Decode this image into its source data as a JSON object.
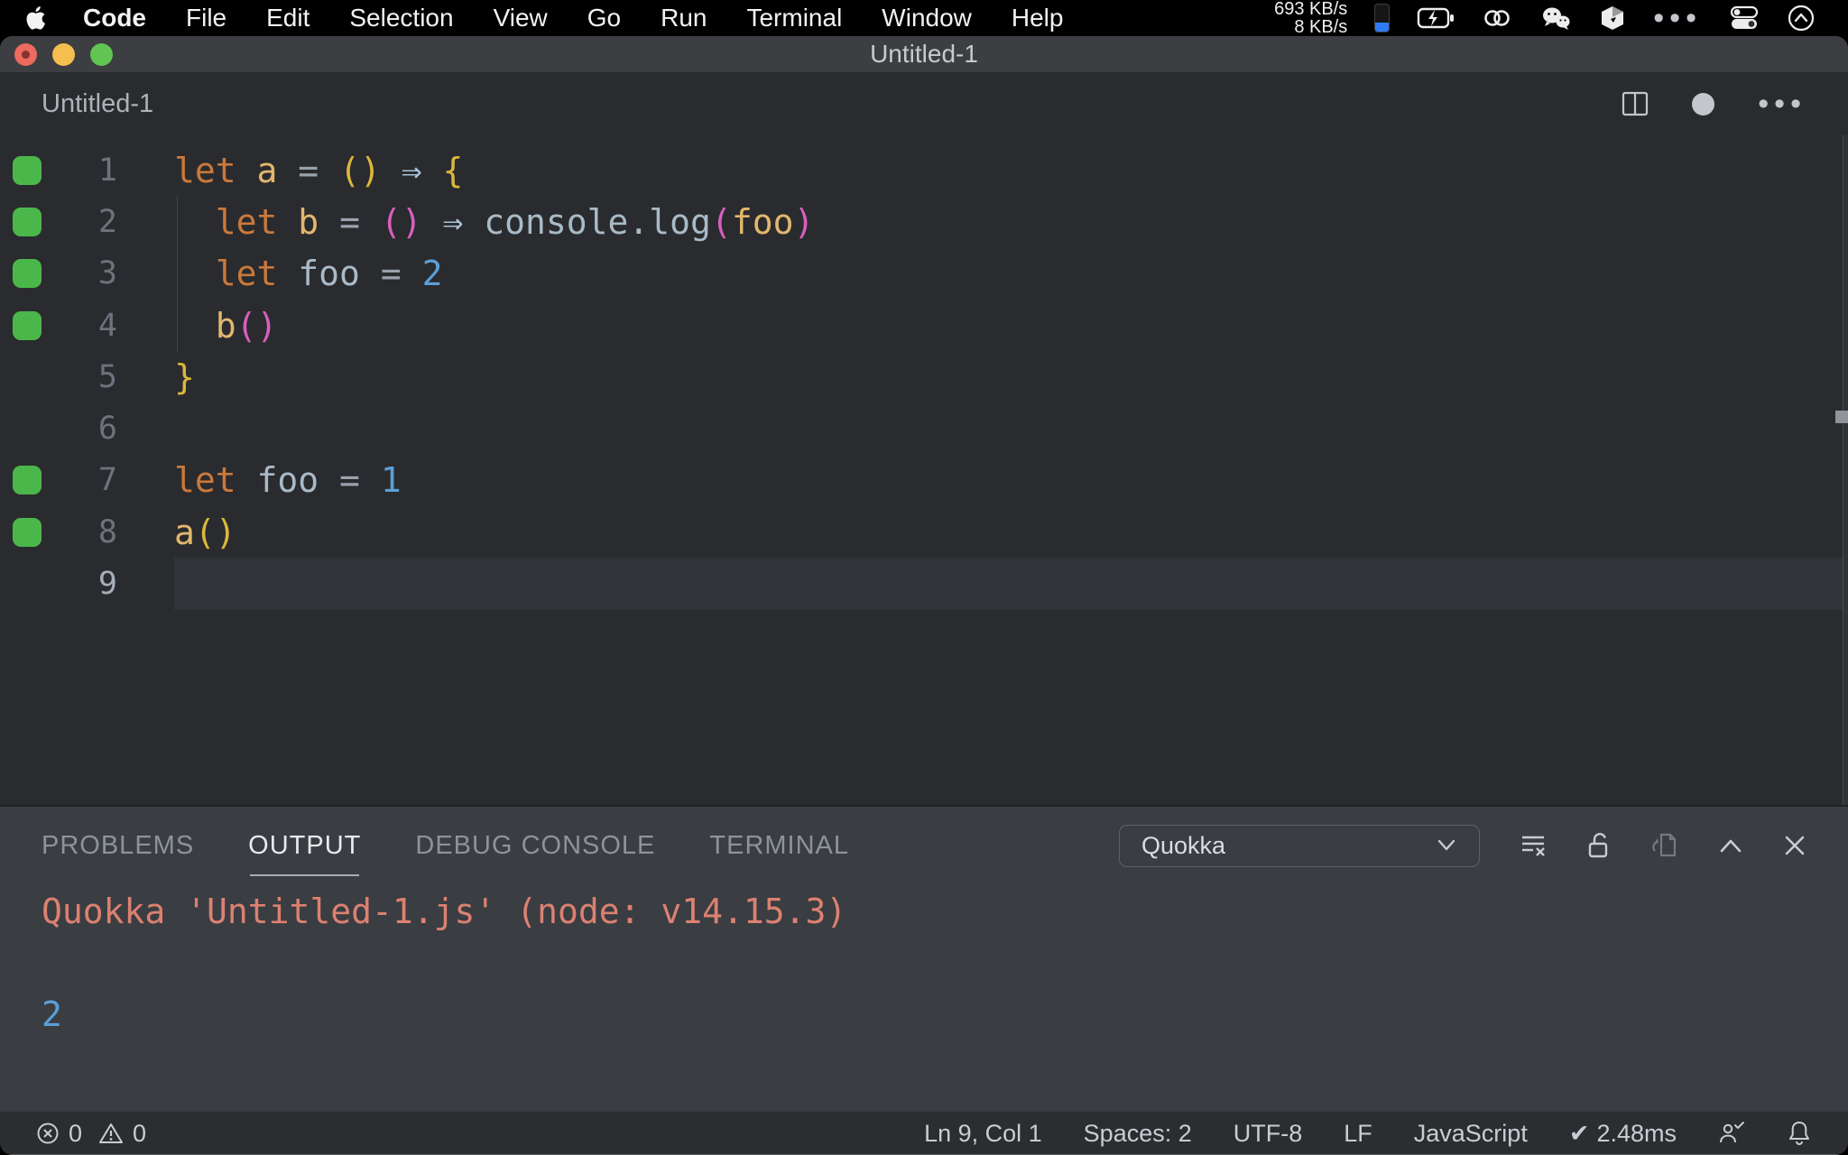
{
  "menu_bar": {
    "items": [
      "Code",
      "File",
      "Edit",
      "Selection",
      "View",
      "Go",
      "Run",
      "Terminal",
      "Window",
      "Help"
    ],
    "network_up": "693 KB/s",
    "network_down": "8 KB/s"
  },
  "window": {
    "title": "Untitled-1"
  },
  "editor": {
    "tab_label": "Untitled-1",
    "coverage_color": "#4bb74b",
    "token_colors": {
      "kw": "#c9793c",
      "var": "#e2b76d",
      "id": "#a9bac7",
      "fn": "#a9bac7",
      "op": "#9aa2ad",
      "b1": "#dcb73e",
      "b2": "#d75fc0",
      "num": "#5b9fd6",
      "arrow": "#a9c3d9",
      "plain": "#c9ccd1"
    },
    "lines": [
      {
        "num": "1",
        "covered": true,
        "guide": false,
        "current": false,
        "tokens": [
          [
            "let ",
            "kw"
          ],
          [
            "a",
            "var"
          ],
          [
            " ",
            "plain"
          ],
          [
            "=",
            "op"
          ],
          [
            " ",
            "plain"
          ],
          [
            "()",
            "b1"
          ],
          [
            " ",
            "plain"
          ],
          [
            "⇒",
            "arrow"
          ],
          [
            " ",
            "plain"
          ],
          [
            "{",
            "b1"
          ]
        ]
      },
      {
        "num": "2",
        "covered": true,
        "guide": true,
        "current": false,
        "tokens": [
          [
            "  ",
            "plain"
          ],
          [
            "let ",
            "kw"
          ],
          [
            "b",
            "var"
          ],
          [
            " ",
            "plain"
          ],
          [
            "=",
            "op"
          ],
          [
            " ",
            "plain"
          ],
          [
            "()",
            "b2"
          ],
          [
            " ",
            "plain"
          ],
          [
            "⇒",
            "arrow"
          ],
          [
            " ",
            "plain"
          ],
          [
            "console.log",
            "fn"
          ],
          [
            "(",
            "b2"
          ],
          [
            "foo",
            "var"
          ],
          [
            ")",
            "b2"
          ]
        ]
      },
      {
        "num": "3",
        "covered": true,
        "guide": true,
        "current": false,
        "tokens": [
          [
            "  ",
            "plain"
          ],
          [
            "let ",
            "kw"
          ],
          [
            "foo",
            "id"
          ],
          [
            " ",
            "plain"
          ],
          [
            "=",
            "op"
          ],
          [
            " ",
            "plain"
          ],
          [
            "2",
            "num"
          ]
        ]
      },
      {
        "num": "4",
        "covered": true,
        "guide": true,
        "current": false,
        "tokens": [
          [
            "  ",
            "plain"
          ],
          [
            "b",
            "var"
          ],
          [
            "()",
            "b2"
          ]
        ]
      },
      {
        "num": "5",
        "covered": false,
        "guide": false,
        "current": false,
        "tokens": [
          [
            "}",
            "b1"
          ]
        ]
      },
      {
        "num": "6",
        "covered": false,
        "guide": false,
        "current": false,
        "tokens": []
      },
      {
        "num": "7",
        "covered": true,
        "guide": false,
        "current": false,
        "tokens": [
          [
            "let ",
            "kw"
          ],
          [
            "foo",
            "id"
          ],
          [
            " ",
            "plain"
          ],
          [
            "=",
            "op"
          ],
          [
            " ",
            "plain"
          ],
          [
            "1",
            "num"
          ]
        ]
      },
      {
        "num": "8",
        "covered": true,
        "guide": false,
        "current": false,
        "tokens": [
          [
            "a",
            "var"
          ],
          [
            "()",
            "b1"
          ]
        ]
      },
      {
        "num": "9",
        "covered": false,
        "guide": false,
        "current": true,
        "tokens": []
      }
    ]
  },
  "panel": {
    "tabs": [
      {
        "label": "PROBLEMS",
        "active": false
      },
      {
        "label": "OUTPUT",
        "active": true
      },
      {
        "label": "DEBUG CONSOLE",
        "active": false
      },
      {
        "label": "TERMINAL",
        "active": false
      }
    ],
    "channel": "Quokka",
    "output_lines": [
      {
        "text": "Quokka 'Untitled-1.js' (node: v14.15.3)",
        "color": "#dc8170"
      },
      {
        "text": "",
        "color": "#c9ccd1"
      },
      {
        "text": "2",
        "color": "#5b9fd6"
      }
    ]
  },
  "status_bar": {
    "errors": "0",
    "warnings": "0",
    "cursor": "Ln 9, Col 1",
    "indent": "Spaces: 2",
    "encoding": "UTF-8",
    "eol": "LF",
    "language": "JavaScript",
    "perf_icon": "✔",
    "perf": "2.48ms"
  }
}
